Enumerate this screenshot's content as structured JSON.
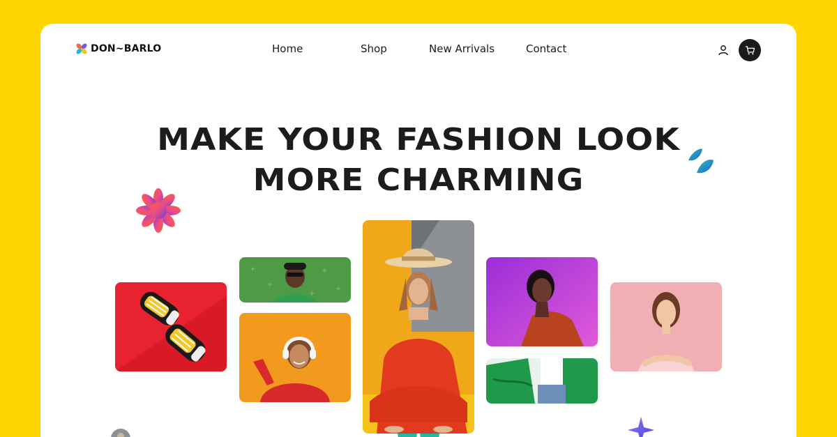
{
  "brand": {
    "name": "DON~BARLO",
    "logo_icon": "four-petal-logo-icon"
  },
  "nav": {
    "items": [
      "Home",
      "Shop",
      "New Arrivals",
      "Contact"
    ]
  },
  "header_icons": {
    "account": "user-icon",
    "cart": "cart-icon"
  },
  "hero": {
    "line1": "MAKE YOUR FASHION LOOK",
    "line2": "MORE CHARMING"
  },
  "gallery": [
    {
      "name": "sneakers-photo",
      "subject": "black checkered sneakers on red"
    },
    {
      "name": "man-green-photo",
      "subject": "man in sunglasses on green"
    },
    {
      "name": "woman-headphones-photo",
      "subject": "woman with headphones on orange"
    },
    {
      "name": "woman-hat-photo",
      "subject": "woman in hat sitting, red outfit"
    },
    {
      "name": "woman-purple-photo",
      "subject": "woman on purple neon background"
    },
    {
      "name": "green-jacket-photo",
      "subject": "green jacket closeup"
    },
    {
      "name": "woman-pink-photo",
      "subject": "woman on pink background"
    }
  ],
  "colors": {
    "background": "#FFD500",
    "card": "#FFFFFF",
    "text": "#1C1C1C",
    "cart_button": "#1B1B1B"
  }
}
